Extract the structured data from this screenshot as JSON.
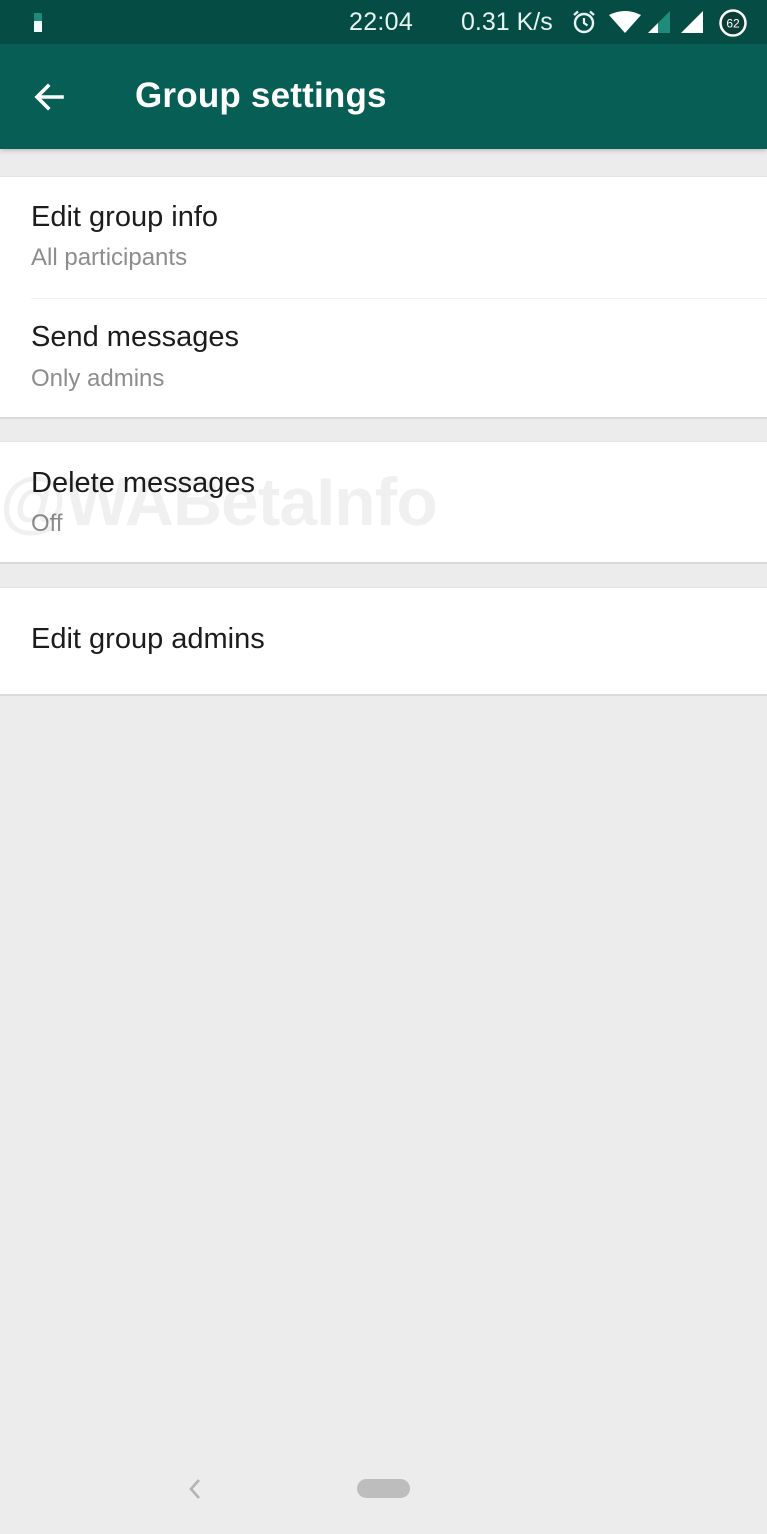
{
  "status_bar": {
    "time": "22:04",
    "network_speed": "0.31 K/s",
    "battery_level": "62",
    "icons": [
      "battery-small-icon",
      "alarm-icon",
      "wifi-icon",
      "signal-icon",
      "signal-icon",
      "battery-ring-icon"
    ]
  },
  "app_bar": {
    "back_icon": "arrow-left-icon",
    "title": "Group settings",
    "color": "#075e54",
    "status_color": "#054d44"
  },
  "settings": {
    "edit_group_info": {
      "label": "Edit group info",
      "value": "All participants"
    },
    "send_messages": {
      "label": "Send messages",
      "value": "Only admins"
    },
    "delete_messages": {
      "label": "Delete messages",
      "value": "Off"
    },
    "edit_group_admins": {
      "label": "Edit group admins"
    }
  },
  "watermark": "@WABetaInfo",
  "nav_bar": {
    "back_icon": "chevron-left-icon",
    "home_icon": "home-pill-icon"
  }
}
